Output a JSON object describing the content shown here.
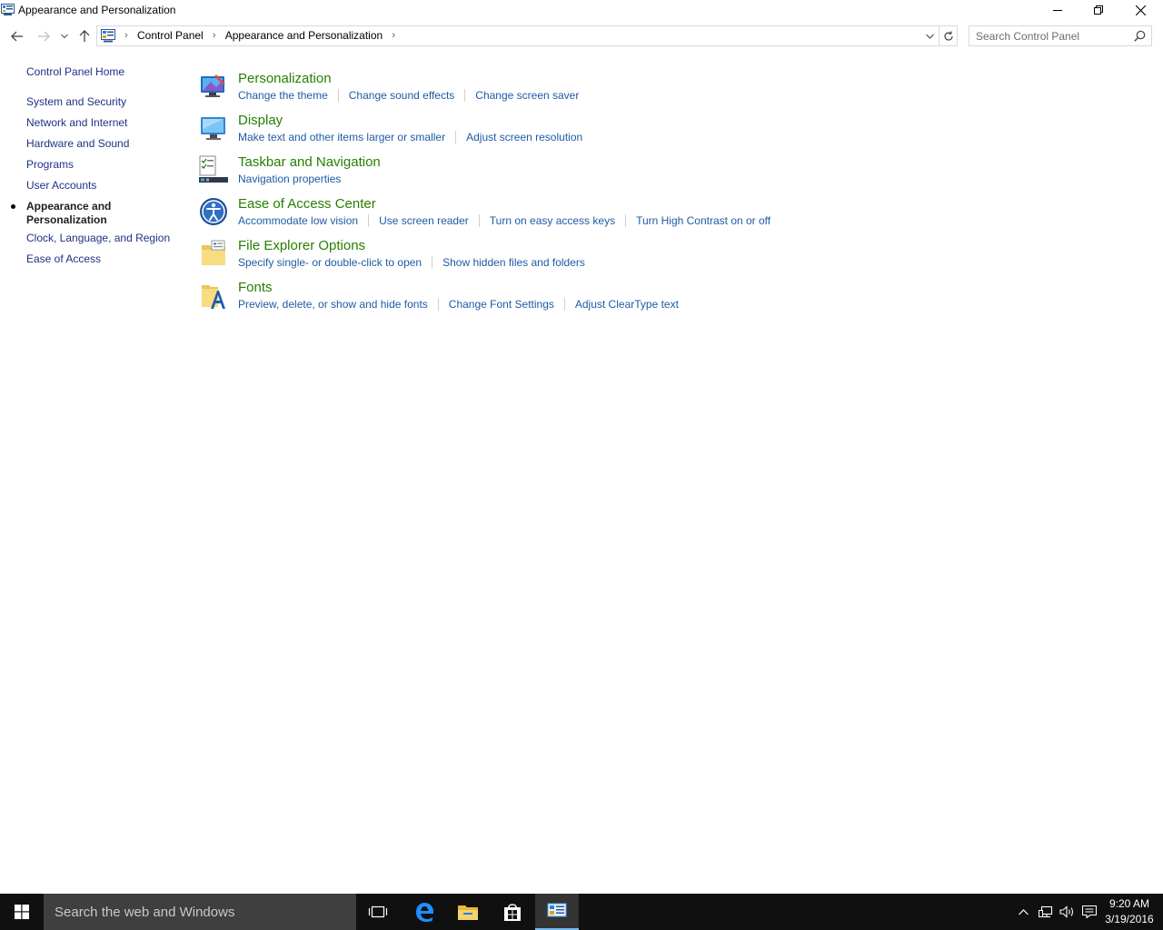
{
  "window": {
    "title": "Appearance and Personalization"
  },
  "address": {
    "breadcrumbs": [
      "Control Panel",
      "Appearance and Personalization"
    ],
    "search_placeholder": "Search Control Panel"
  },
  "leftnav": {
    "home": "Control Panel Home",
    "items": [
      "System and Security",
      "Network and Internet",
      "Hardware and Sound",
      "Programs",
      "User Accounts"
    ],
    "current": "Appearance and Personalization",
    "items_after": [
      "Clock, Language, and Region",
      "Ease of Access"
    ]
  },
  "categories": [
    {
      "title": "Personalization",
      "icon": "personalization-icon",
      "links": [
        "Change the theme",
        "Change sound effects",
        "Change screen saver"
      ]
    },
    {
      "title": "Display",
      "icon": "display-icon",
      "links": [
        "Make text and other items larger or smaller",
        "Adjust screen resolution"
      ]
    },
    {
      "title": "Taskbar and Navigation",
      "icon": "taskbar-icon",
      "links": [
        "Navigation properties"
      ]
    },
    {
      "title": "Ease of Access Center",
      "icon": "ease-of-access-icon",
      "links": [
        "Accommodate low vision",
        "Use screen reader",
        "Turn on easy access keys",
        "Turn High Contrast on or off"
      ]
    },
    {
      "title": "File Explorer Options",
      "icon": "folder-options-icon",
      "links": [
        "Specify single- or double-click to open",
        "Show hidden files and folders"
      ]
    },
    {
      "title": "Fonts",
      "icon": "fonts-icon",
      "links": [
        "Preview, delete, or show and hide fonts",
        "Change Font Settings",
        "Adjust ClearType text"
      ]
    }
  ],
  "taskbar": {
    "search_text": "Search the web and Windows",
    "time": "9:20 AM",
    "date": "3/19/2016"
  },
  "colors": {
    "category_title": "#267f00",
    "link": "#1e5ba6",
    "nav_link": "#1e3287",
    "taskbar": "#101010"
  }
}
